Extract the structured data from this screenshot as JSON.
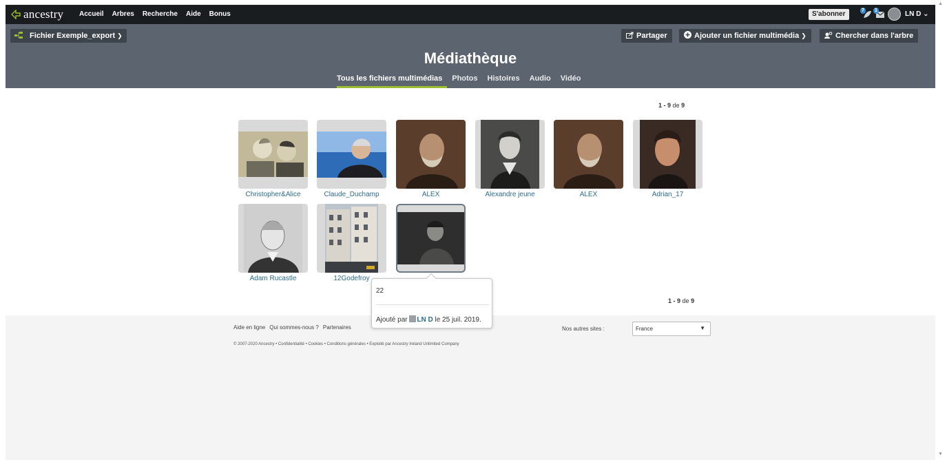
{
  "nav": {
    "logo": "ancestry",
    "items": [
      "Accueil",
      "Arbres",
      "Recherche",
      "Aide",
      "Bonus"
    ],
    "subscribe": "S'abonner",
    "hint_badge": "7",
    "message_badge": "1",
    "user": "LN D"
  },
  "tree": {
    "name": "Fichier Exemple_export",
    "share": "Partager",
    "add_media": "Ajouter un fichier multimédia",
    "search_tree": "Chercher dans l'arbre"
  },
  "page_title": "Médiathèque",
  "tabs": [
    "Tous les fichiers multimédias",
    "Photos",
    "Histoires",
    "Audio",
    "Vidéo"
  ],
  "pager": {
    "range": "1 - 9",
    "of_label": "de",
    "total": "9"
  },
  "media": [
    {
      "caption": "Christopher&Alice",
      "kind": "couple"
    },
    {
      "caption": "Claude_Duchamp",
      "kind": "man-blue"
    },
    {
      "caption": "ALEX",
      "kind": "sepia-man"
    },
    {
      "caption": "Alexandre jeune",
      "kind": "young-man"
    },
    {
      "caption": "ALEX",
      "kind": "sepia-man"
    },
    {
      "caption": "Adrian_17",
      "kind": "teen"
    },
    {
      "caption": "Adam Rucastle",
      "kind": "old-man"
    },
    {
      "caption": "12Godefroy",
      "kind": "building"
    },
    {
      "caption": "",
      "kind": "child"
    }
  ],
  "tooltip": {
    "title": "22",
    "added_prefix": "Ajouté par",
    "user": "LN D",
    "date": "le 25 juil. 2019."
  },
  "footer": {
    "links": [
      "Aide en ligne",
      "Qui sommes-nous ?",
      "Partenaires"
    ],
    "copyright": "© 2007-2020 Ancestry • Confidentialité • Cookies • Conditions générales • Exploité par Ancestry Ireland Unlimited Company",
    "sites_label": "Nos autres sites :",
    "sites_value": "France"
  },
  "colors": {
    "topnav": "#1a1d20",
    "header": "#5c656f",
    "accent": "#9cbe30",
    "link": "#2c6b8f"
  }
}
